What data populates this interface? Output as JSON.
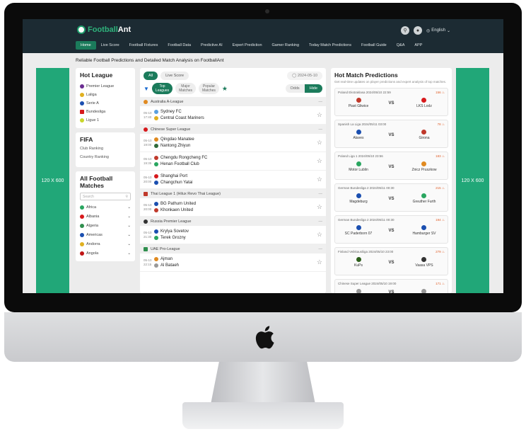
{
  "nav": {
    "logo_prefix": "Football",
    "logo_suffix": "Ant",
    "language": "English",
    "menu": [
      "Home",
      "Live Score",
      "Football Fixtures",
      "Football Data",
      "Predictive AI",
      "Expert Prediction",
      "Gamer Ranking",
      "Today Match Predictions",
      "Football Guide",
      "Q&A",
      "APP"
    ]
  },
  "tagline": "Reliable Football Predictions and Detailed Match Analysis on FootballAnt",
  "ads": {
    "left": "120 X 600",
    "right": "120 X 600"
  },
  "hot_league": {
    "title": "Hot League",
    "items": [
      {
        "label": "Premier League",
        "color": "#6a2c91"
      },
      {
        "label": "Laliga",
        "color": "#e0b020"
      },
      {
        "label": "Serie A",
        "color": "#1b4fb0"
      },
      {
        "label": "Bundesliga",
        "color": "#d7191c"
      },
      {
        "label": "Ligue 1",
        "color": "#c9d62a"
      }
    ]
  },
  "fifa": {
    "title": "FIFA",
    "items": [
      "Club Ranking",
      "Country Ranking"
    ]
  },
  "all_matches": {
    "title_line1": "All Football",
    "title_line2": "Matches",
    "search_placeholder": "Search",
    "countries": [
      {
        "label": "Africa",
        "color": "#2aa660"
      },
      {
        "label": "Albania",
        "color": "#d7191c"
      },
      {
        "label": "Algeria",
        "color": "#2f8f4e"
      },
      {
        "label": "Americas",
        "color": "#1b4fb0"
      },
      {
        "label": "Andorra",
        "color": "#e0b020"
      },
      {
        "label": "Angola",
        "color": "#c01515"
      }
    ]
  },
  "center": {
    "tab_all": "All",
    "tab_live": "Live Score",
    "date": "2024-05-10",
    "filter_top_1": "Top",
    "filter_top_2": "Leagues",
    "filter_major_1": "Major",
    "filter_major_2": "Matches",
    "filter_popular_1": "Popular",
    "filter_popular_2": "Matches",
    "odds": "Odds",
    "hide": "Hide",
    "groups": [
      {
        "league": "Australia A-League",
        "matches": [
          {
            "date": "05-10",
            "time": "17:40",
            "home": "Sydney FC",
            "away": "Central Coast Mariners"
          }
        ]
      },
      {
        "league": "Chinese Super League",
        "matches": [
          {
            "date": "05-10",
            "time": "19:00",
            "home": "Qingdao Manatee",
            "away": "Nantong Zhiyun"
          },
          {
            "date": "05-10",
            "time": "19:35",
            "home": "Chengdu Rongcheng FC",
            "away": "Henan Football Club"
          },
          {
            "date": "05-10",
            "time": "20:00",
            "home": "Shanghai Port",
            "away": "Changchun Yatai"
          }
        ]
      },
      {
        "league": "Thai League 1 (Hilux Revo Thai League)",
        "matches": [
          {
            "date": "05-10",
            "time": "20:00",
            "home": "BG Pathum United",
            "away": "Khonkaen United"
          }
        ]
      },
      {
        "league": "Russia Premier League",
        "matches": [
          {
            "date": "05-10",
            "time": "21:30",
            "home": "Krylya Sovetov",
            "away": "Terek Grozny"
          }
        ]
      },
      {
        "league": "UAE Pro-League",
        "matches": [
          {
            "date": "05-10",
            "time": "22:15",
            "home": "Ajman",
            "away": "Al Bataeh"
          }
        ]
      }
    ]
  },
  "hot_matches": {
    "title": "Hot Match Predictions",
    "subtitle": "Get real-time updates on player predictions and expert analysis of top matches.",
    "vs": "VS",
    "items": [
      {
        "league": "Poland Ekstraklasa 2024/05/10 22:59",
        "count": "156",
        "home": "Piast Gliwice",
        "away": "LKS Lodz",
        "hc": "#c0392b",
        "ac": "#d7191c"
      },
      {
        "league": "Spanish La Liga 2024/05/11 03:00",
        "count": "78",
        "home": "Alaves",
        "away": "Girona",
        "hc": "#1b4fb0",
        "ac": "#c0392b"
      },
      {
        "league": "Poland Liga 1 2024/05/10 23:56",
        "count": "183",
        "home": "Motor Lublin",
        "away": "Znicz Pruszkow",
        "hc": "#2aa660",
        "ac": "#e08a20"
      },
      {
        "league": "German Bundesliga 2 2024/05/11 00:30",
        "count": "215",
        "home": "Magdeburg",
        "away": "Greuther Furth",
        "hc": "#1b4fb0",
        "ac": "#2aa660"
      },
      {
        "league": "German Bundesliga 2 2024/05/11 00:30",
        "count": "194",
        "home": "SC Paderborn 07",
        "away": "Hamburger SV",
        "hc": "#1b4fb0",
        "ac": "#1b4fb0"
      },
      {
        "league": "Finland Veikkausliiga 2024/05/10 23:00",
        "count": "279",
        "home": "KuPs",
        "away": "Vaasa VPS",
        "hc": "#2c5e1a",
        "ac": "#333333"
      },
      {
        "league": "Chinese Super League 2024/05/10 19:00",
        "count": "171",
        "home": "",
        "away": "",
        "hc": "#999999",
        "ac": "#999999"
      }
    ]
  }
}
